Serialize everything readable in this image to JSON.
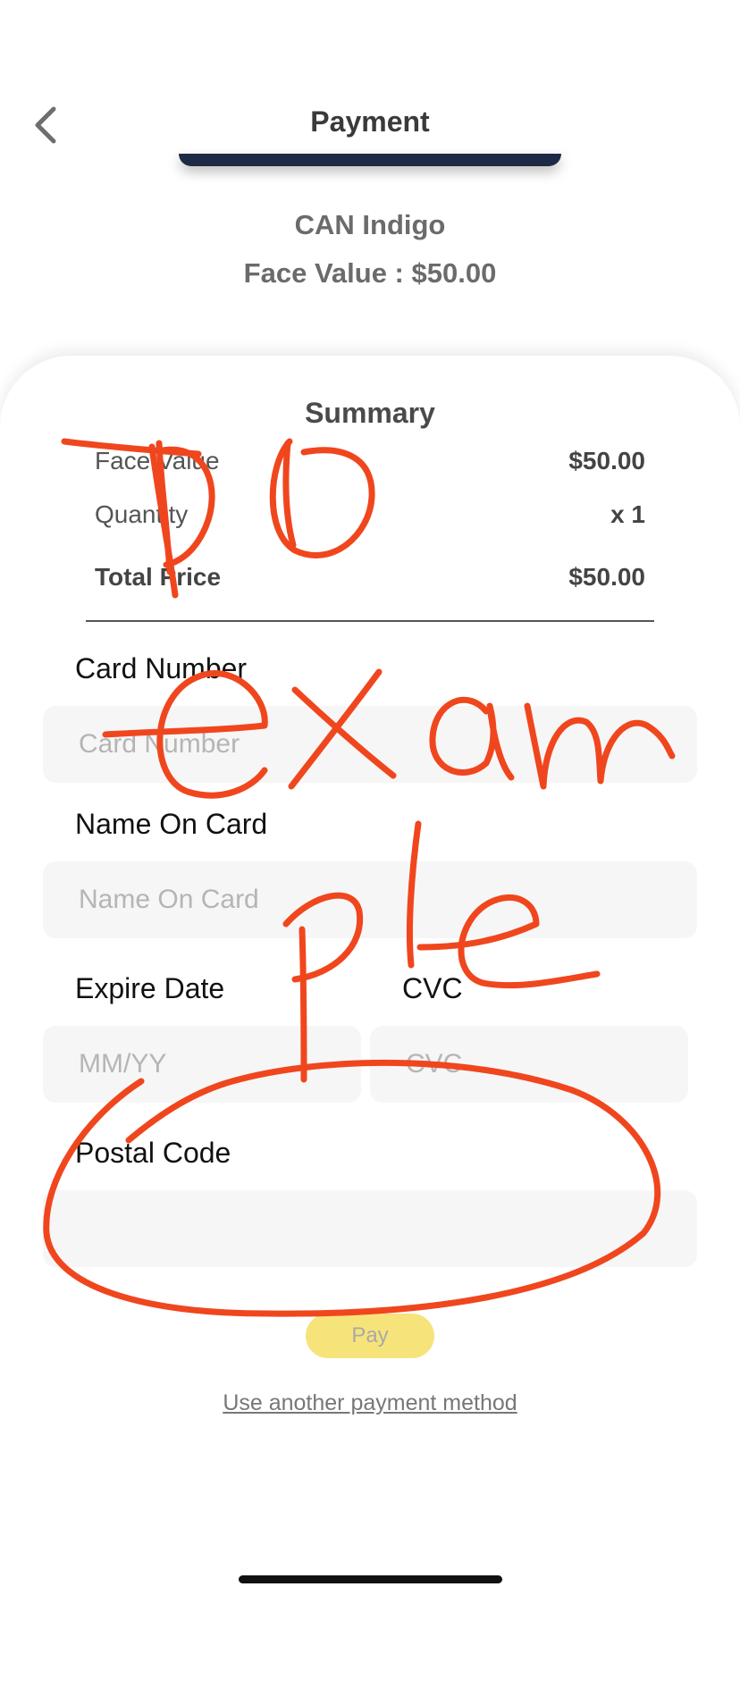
{
  "header": {
    "title": "Payment",
    "back_icon": "chevron-left-icon"
  },
  "product": {
    "name": "CAN Indigo",
    "face_value": "Face Value : $50.00"
  },
  "summary": {
    "title": "Summary",
    "face_value_label": "Face Value",
    "face_value": "$50.00",
    "quantity_label": "Quantity",
    "quantity": "x 1",
    "total_label": "Total Price",
    "total": "$50.00"
  },
  "form": {
    "card_number_label": "Card Number",
    "card_number_placeholder": "Card Number",
    "name_label": "Name On Card",
    "name_placeholder": "Name On Card",
    "expire_label": "Expire Date",
    "expire_placeholder": "MM/YY",
    "cvc_label": "CVC",
    "cvc_placeholder": "CVC",
    "postal_label": "Postal Code",
    "postal_placeholder": ""
  },
  "actions": {
    "pay_label": "Pay",
    "alt_payment_label": "Use another payment method"
  },
  "annotation": {
    "ink_color": "#f0461e"
  },
  "colors": {
    "pay_button": "#f6e47a",
    "card_strip": "#1d2a45"
  }
}
